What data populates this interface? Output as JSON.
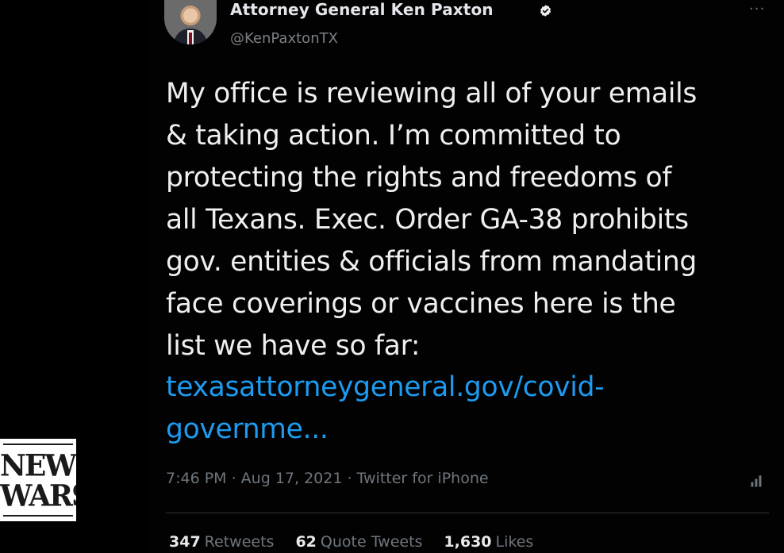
{
  "tweet": {
    "author": {
      "display_name": "Attorney General Ken Paxton",
      "handle": "@KenPaxtonTX",
      "verified_icon": "verified-badge-icon",
      "avatar_icon": "profile-avatar"
    },
    "more_icon": "...",
    "body_text": "My office is reviewing all of your emails\n& taking action. I’m committed to\nprotecting the rights and freedoms of\nall Texans. Exec. Order GA-38 prohibits\ngov. entities & officials from mandating\nface coverings or vaccines here is the\nlist we have so far:",
    "link_text": "texasattorneygeneral.gov/covid-\ngovernme...",
    "meta": "7:46 PM · Aug 17, 2021 · Twitter for iPhone",
    "stats": [
      {
        "count": "347",
        "label": "Retweets"
      },
      {
        "count": "62",
        "label": "Quote Tweets"
      },
      {
        "count": "1,630",
        "label": "Likes"
      }
    ]
  },
  "overlay_logo": {
    "line1": "NEWS",
    "line2": "WARS"
  },
  "colors": {
    "background": "#000000",
    "text": "#e7e9ea",
    "secondary_text": "#6e767d",
    "link": "#1d9bf0",
    "verified": "#ffffff"
  }
}
